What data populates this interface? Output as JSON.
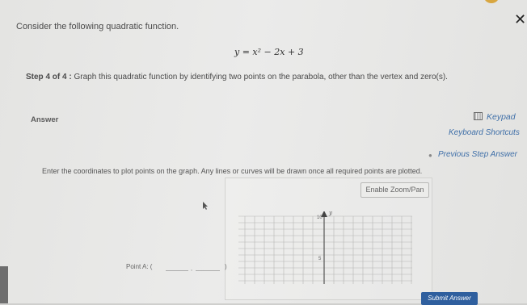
{
  "question": {
    "prompt": "Consider the following quadratic function.",
    "equation": "y = x² − 2x + 3",
    "step_label": "Step 4 of 4 :",
    "step_text": "Graph this quadratic function by identifying two points on the parabola, other than the vertex and zero(s)."
  },
  "answer": {
    "label": "Answer",
    "keypad": "Keypad",
    "keyboard_shortcuts": "Keyboard Shortcuts",
    "previous_step": "Previous Step Answer",
    "instructions": "Enter the coordinates to plot points on the graph. Any lines or curves will be drawn once all required points are plotted.",
    "zoom_button": "Enable Zoom/Pan",
    "point_a_label": "Point A: (",
    "point_a_x": "",
    "point_a_y": "",
    "point_close": ")",
    "submit": "Submit Answer"
  },
  "graph": {
    "y_axis_label": "y",
    "tick_top": "10",
    "tick_mid": "5"
  },
  "colors": {
    "link": "#3f6fa8",
    "submit_bg": "#2f5f9e"
  }
}
